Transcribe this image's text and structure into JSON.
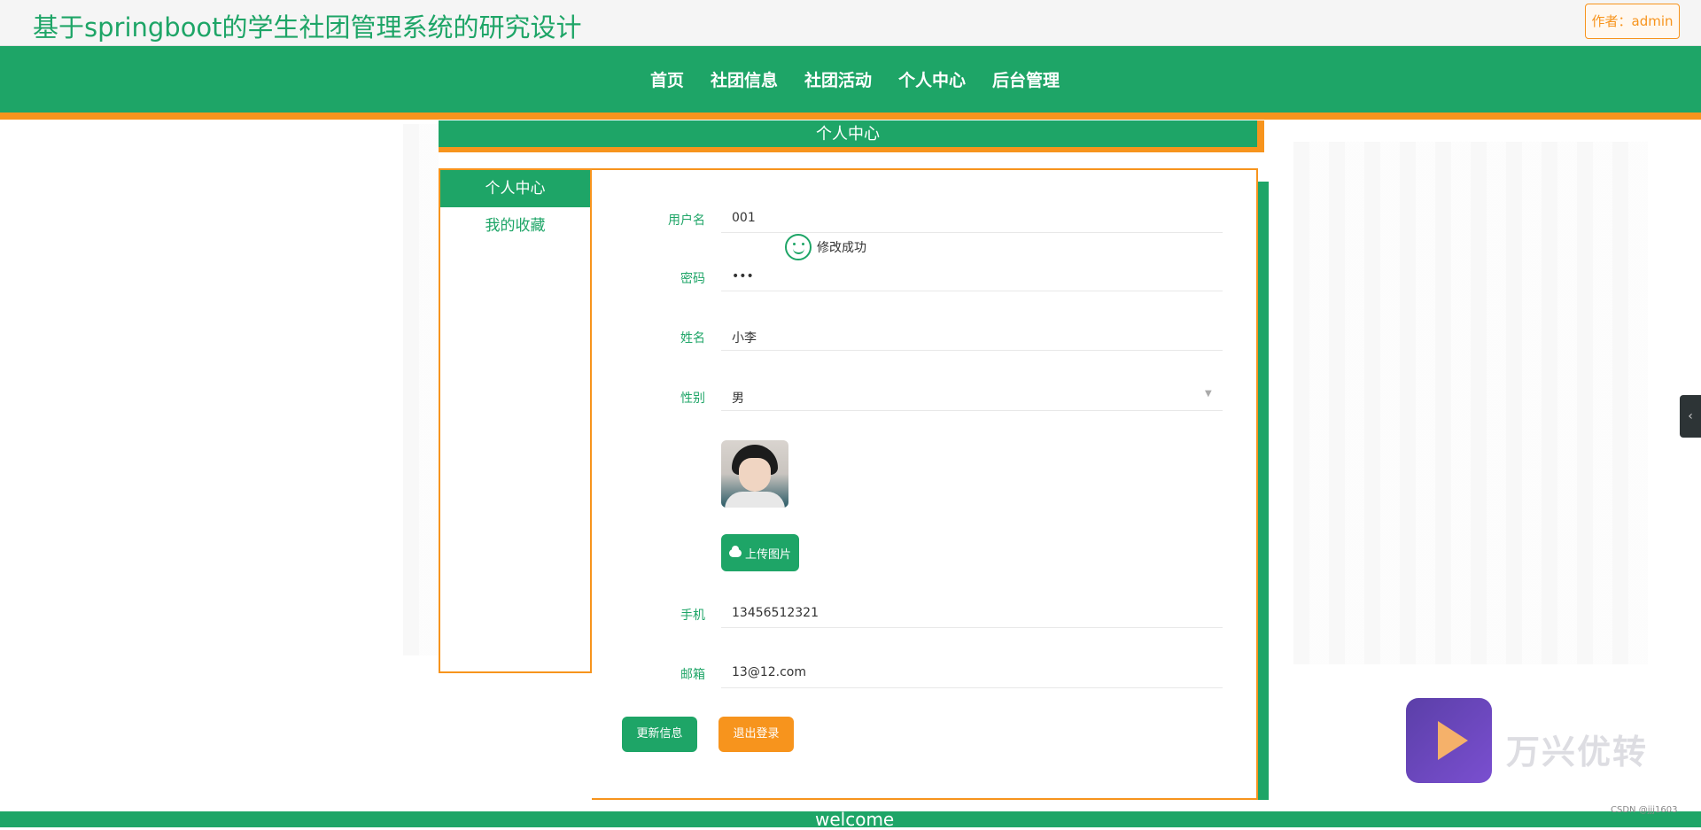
{
  "header": {
    "site_title": "基于springboot的学生社团管理系统的研究设计",
    "author_label": "作者：admin"
  },
  "nav": {
    "items": [
      "首页",
      "社团信息",
      "社团活动",
      "个人中心",
      "后台管理"
    ]
  },
  "section": {
    "title": "个人中心"
  },
  "sidebar": {
    "items": [
      {
        "label": "个人中心",
        "active": true
      },
      {
        "label": "我的收藏",
        "active": false
      }
    ]
  },
  "toast": {
    "message": "修改成功",
    "icon": "smiley-icon"
  },
  "form": {
    "username_label": "用户名",
    "username_value": "001",
    "password_label": "密码",
    "password_value": "•••",
    "name_label": "姓名",
    "name_value": "小李",
    "gender_label": "性别",
    "gender_value": "男",
    "upload_label": "上传图片",
    "phone_label": "手机",
    "phone_value": "13456512321",
    "email_label": "邮箱",
    "email_value": "13@12.com"
  },
  "actions": {
    "update_label": "更新信息",
    "logout_label": "退出登录"
  },
  "footer": {
    "text": "welcome"
  },
  "watermark": {
    "brand_text": "万兴优转",
    "credit": "CSDN @jjj1603"
  },
  "colors": {
    "primary": "#1ea567",
    "accent": "#f7941d"
  }
}
